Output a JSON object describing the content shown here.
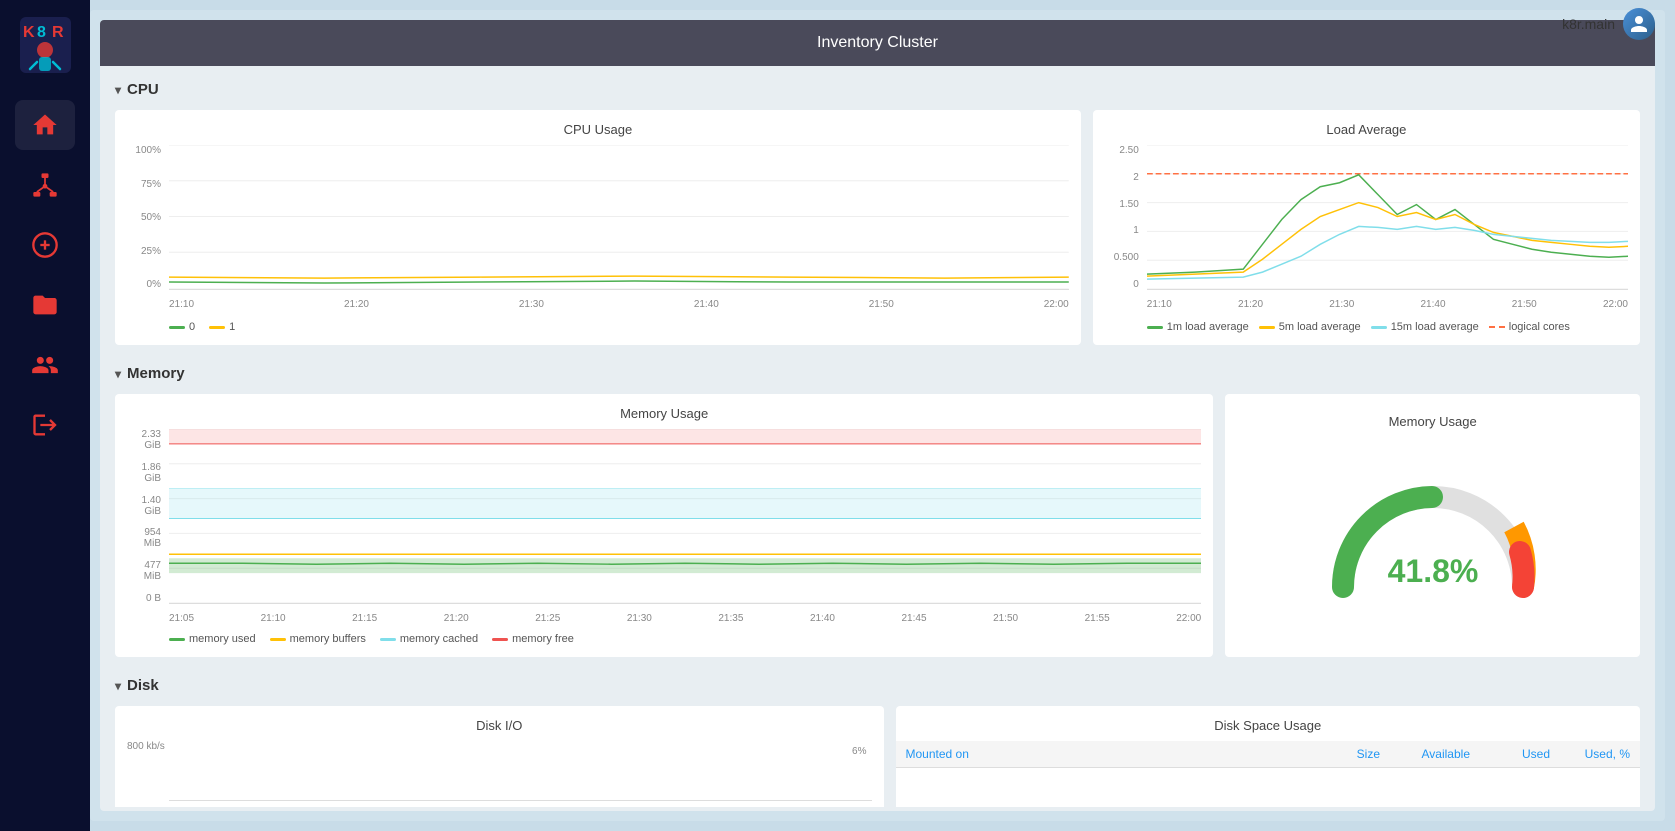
{
  "app": {
    "title": "k8r.main"
  },
  "sidebar": {
    "logo_text": "K8R",
    "items": [
      {
        "id": "home",
        "label": "Home",
        "active": true
      },
      {
        "id": "network",
        "label": "Network"
      },
      {
        "id": "add",
        "label": "Add"
      },
      {
        "id": "folder",
        "label": "Folder"
      },
      {
        "id": "users",
        "label": "Users"
      },
      {
        "id": "logout",
        "label": "Logout"
      }
    ]
  },
  "window": {
    "title": "Inventory Cluster"
  },
  "sections": {
    "cpu": {
      "label": "CPU",
      "cpu_usage": {
        "title": "CPU Usage",
        "y_labels": [
          "100%",
          "75%",
          "50%",
          "25%",
          "0%"
        ],
        "x_labels": [
          "21:10",
          "21:20",
          "21:30",
          "21:40",
          "21:50",
          "22:00"
        ],
        "legend": [
          {
            "label": "0",
            "color": "#4CAF50"
          },
          {
            "label": "1",
            "color": "#FFC107"
          }
        ]
      },
      "load_average": {
        "title": "Load Average",
        "y_labels": [
          "2.50",
          "2",
          "1.50",
          "1",
          "0.500",
          "0"
        ],
        "x_labels": [
          "21:10",
          "21:20",
          "21:30",
          "21:40",
          "21:50",
          "22:00"
        ],
        "value": "2.50",
        "legend": [
          {
            "label": "1m load average",
            "color": "#4CAF50"
          },
          {
            "label": "5m load average",
            "color": "#FFC107"
          },
          {
            "label": "15m load average",
            "color": "#80DEEA"
          },
          {
            "label": "logical cores",
            "color": "#FF7043",
            "dashed": true
          }
        ]
      }
    },
    "memory": {
      "label": "Memory",
      "memory_usage_chart": {
        "title": "Memory Usage",
        "y_labels": [
          "2.33 GiB",
          "1.86 GiB",
          "1.40 GiB",
          "954 MiB",
          "477 MiB",
          "0 B"
        ],
        "x_labels": [
          "21:05",
          "21:10",
          "21:15",
          "21:20",
          "21:25",
          "21:30",
          "21:35",
          "21:40",
          "21:45",
          "21:50",
          "21:55",
          "22:00"
        ],
        "legend": [
          {
            "label": "memory used",
            "color": "#4CAF50"
          },
          {
            "label": "memory buffers",
            "color": "#FFC107"
          },
          {
            "label": "memory cached",
            "color": "#80DEEA"
          },
          {
            "label": "memory free",
            "color": "#EF5350"
          }
        ]
      },
      "memory_gauge": {
        "title": "Memory Usage",
        "value": 41.8,
        "value_label": "41.8%",
        "color_green": "#4CAF50",
        "color_orange": "#FF9800",
        "color_red": "#F44336"
      }
    },
    "disk": {
      "label": "Disk",
      "disk_io": {
        "title": "Disk I/O",
        "y_labels": [
          "800 kb/s",
          "6%"
        ],
        "x_labels": []
      },
      "disk_space": {
        "title": "Disk Space Usage",
        "columns": [
          "Mounted on",
          "Size",
          "Available",
          "Used",
          "Used, %"
        ]
      }
    }
  }
}
